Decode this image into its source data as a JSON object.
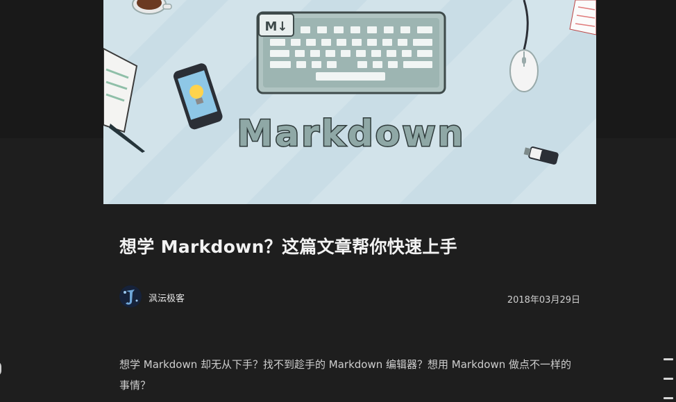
{
  "hero": {
    "caption": "Markdown",
    "keyboard_badge": "M↓"
  },
  "article": {
    "title": "想学 Markdown？这篇文章帮你快速上手",
    "author": "沨沄极客",
    "date": "2018年03月29日",
    "intro": "想学 Markdown 却无从下手？找不到趁手的 Markdown 编辑器？想用 Markdown 做点不一样的事情？"
  }
}
